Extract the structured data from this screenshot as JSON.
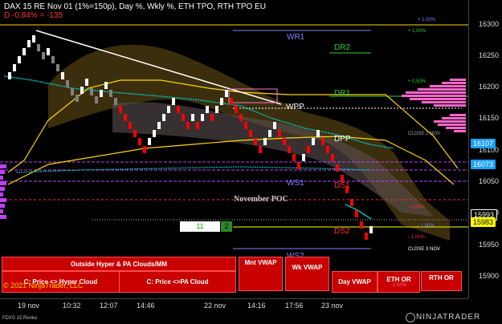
{
  "header": {
    "instrument_line": "DAX 15 RE Nov 01 (1%=150p), Day %, Wkly %, ETH TPO, RTH TPO EU",
    "change_line": "D -0.84% = -135"
  },
  "levels": {
    "wr1": "WR1",
    "dr2": "DR2",
    "dr1": "DR1",
    "wpp": "WPP",
    "dpp": "DPP",
    "ws1": "WS1",
    "ds1": "DS1",
    "ds2": "DS2",
    "ws2": "WS2",
    "poc": "November POC"
  },
  "pct_labels": {
    "p100_top": "+ 1.00%",
    "p100": "+ 1,00%",
    "p050": "+ 0,50%",
    "m050": "- 0.50%",
    "m100_a": "- 1.00%",
    "m100_b": "- 1.00%",
    "close2": "CLOSE 2 NOV",
    "close3": "CLOSE 3 NOV"
  },
  "counter": {
    "left": "11",
    "right": "2"
  },
  "price_axis": {
    "ticks": [
      "16300",
      "16250",
      "16200",
      "16150",
      "16100",
      "16050",
      "16000",
      "15950",
      "15900"
    ],
    "labels": [
      {
        "text": "16107",
        "color": "#1aa0ff"
      },
      {
        "text": "16073",
        "color": "#1aa0ff"
      },
      {
        "text": "15993",
        "color": "#ffffff"
      },
      {
        "text": "15983",
        "color": "#ffff00"
      }
    ]
  },
  "time_axis": [
    "19 nov",
    "10:32",
    "12:07",
    "14:46",
    "22 nov",
    "14:16",
    "17:56",
    "23 nov"
  ],
  "buttons": {
    "outside_hyper": "Outside Hyper & PA Clouds/MM",
    "price_hyper": "C: Price <> Hyper Cloud",
    "price_pa": "C: Price <>PA Cloud",
    "mnt_vwap": "Mnt VWAP",
    "wk_vwap": "Wk VWAP",
    "day_vwap": "Day VWAP",
    "eth_or": "ETH OR",
    "eth_or_sub": "-1.50%",
    "rth_or": "RTH OR"
  },
  "footer": {
    "symbol": "FDXS 15 Renko",
    "copyright": "© 2021 NinjaTrader, LLC",
    "brand": "NINJATRADER"
  },
  "colors": {
    "bull": "#ffffff",
    "bear": "#ff0000",
    "neutral": "#808080",
    "pivot": "#ffd700",
    "weekly_lvl": "#8080ff",
    "green_lvl": "#33cc33",
    "vwap": "#00c0c0",
    "purple": "#c040ff",
    "tpo": "#ff66cc",
    "button": "#c80000"
  }
}
